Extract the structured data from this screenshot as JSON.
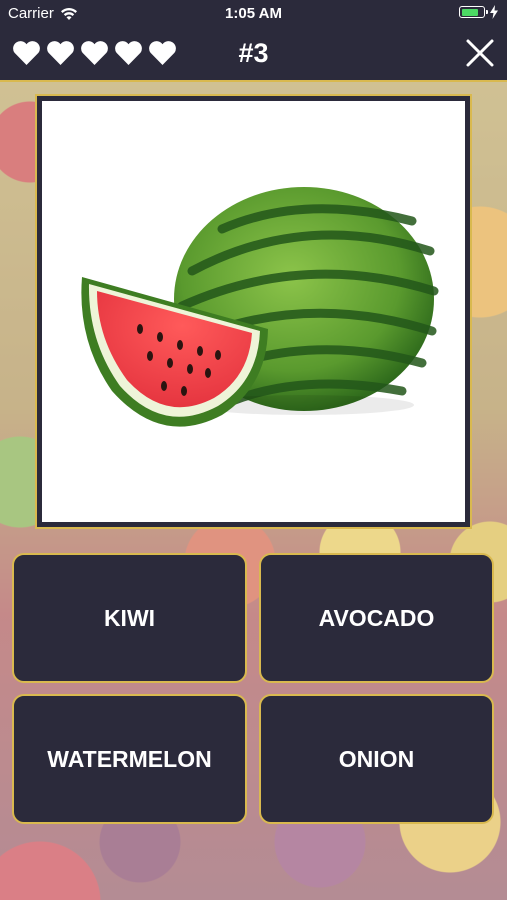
{
  "status_bar": {
    "carrier": "Carrier",
    "time": "1:05 AM",
    "icons": [
      "wifi-icon",
      "battery-icon",
      "charging-bolt-icon"
    ]
  },
  "header": {
    "lives": 5,
    "level": "#3",
    "close_icon": "close-icon",
    "colors": {
      "bar": "#2b2a3b",
      "accent": "#d9b94f",
      "text": "#ffffff"
    }
  },
  "question": {
    "image": "watermelon-image"
  },
  "answers": [
    {
      "label": "KIWI"
    },
    {
      "label": "AVOCADO"
    },
    {
      "label": "WATERMELON"
    },
    {
      "label": "ONION"
    }
  ]
}
